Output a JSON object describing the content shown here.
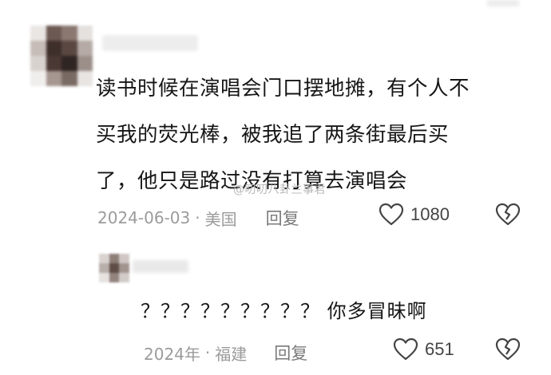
{
  "comment": {
    "text": "读书时候在演唱会门口摆地摊，有个人不\n买我的荧光棒，被我追了两条街最后买\n了，他只是路过没有打算去演唱会",
    "date": "2024-06-03",
    "location": "美国",
    "separator": "·",
    "reply_label": "回复",
    "like_count": "1080",
    "watermark": "@叨叨八卦兰事君"
  },
  "reply": {
    "text": "？？？？？？？？？ 你多冒昧啊",
    "date": "2024年",
    "location": "福建",
    "separator": "·",
    "reply_label": "回复",
    "like_count": "651"
  },
  "icons": {
    "like": "heart-outline-icon",
    "dislike": "broken-heart-icon"
  },
  "colors": {
    "text": "#161616",
    "meta": "#9b9b9b",
    "icon": "#444444"
  }
}
